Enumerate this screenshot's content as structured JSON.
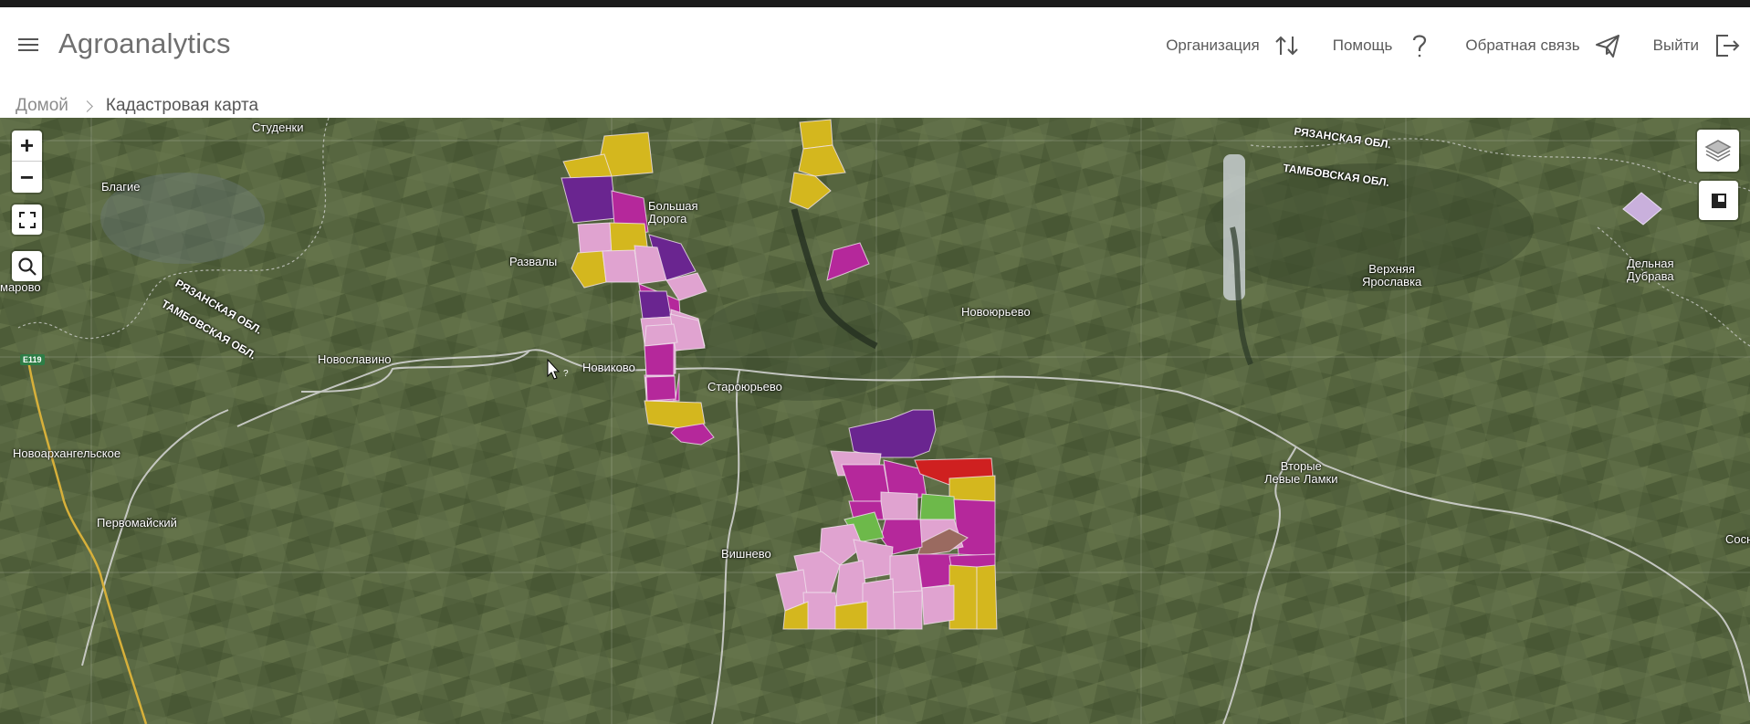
{
  "header": {
    "app_title": "Agroanalytics",
    "nav": {
      "organization": "Организация",
      "help": "Помощь",
      "feedback": "Обратная связь",
      "logout": "Выйти"
    }
  },
  "breadcrumb": {
    "home": "Домой",
    "current": "Кадастровая карта"
  },
  "map": {
    "controls": {
      "zoom_in": "+",
      "zoom_out": "−"
    },
    "road_badge": "E119",
    "places": {
      "studenki": "Студенки",
      "blagie": "Благие",
      "bolshaya_doroga": "Большая\nДорога",
      "razvaly": "Развалы",
      "marovo": "марово",
      "novoslavino": "Новославино",
      "novikovo": "Новиково",
      "staroyurevo": "Староюрьево",
      "novoyurevo": "Новоюрьево",
      "verkhnyaya_yaroslavka": "Верхняя\nЯрославка",
      "delnaya_dubrava": "Дельная\nДубрава",
      "novoarkhangelskoe": "Новоархангельское",
      "pervomaysky": "Первомайский",
      "vishnevo": "Вишнево",
      "vtorye_levye_lamki": "Вторые\nЛевые Ламки",
      "sosn": "Сосн"
    },
    "regions": {
      "ryazan_top": "РЯЗАНСКАЯ ОБЛ.",
      "tambov_top": "ТАМБОВСКАЯ ОБЛ.",
      "ryazan_left": "РЯЗАНСКАЯ ОБЛ.",
      "tambov_left": "ТАМБОВСКАЯ ОБЛ."
    },
    "colors": {
      "yellow": "#d4b71e",
      "magenta": "#b5289b",
      "purple": "#6a2590",
      "pink": "#e0a3d0",
      "green": "#6db94a",
      "red": "#cf2020",
      "brown": "#9a6a60",
      "lavender": "#c9b0dc"
    }
  }
}
